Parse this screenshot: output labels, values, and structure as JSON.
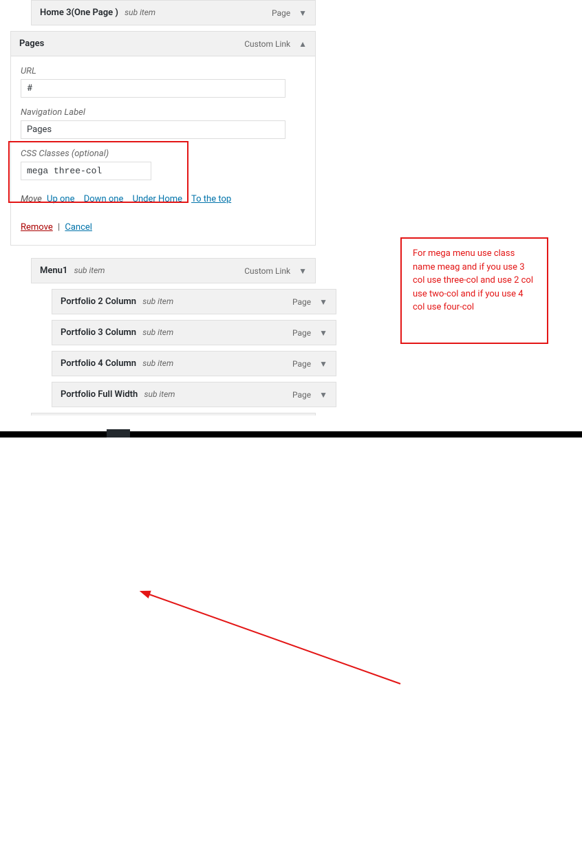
{
  "items": {
    "home3": {
      "title": "Home 3(One Page )",
      "sub": "sub item",
      "type": "Page"
    },
    "pages": {
      "title": "Pages",
      "type": "Custom Link"
    },
    "menu1": {
      "title": "Menu1",
      "sub": "sub item",
      "type": "Custom Link"
    },
    "pf2": {
      "title": "Portfolio 2 Column",
      "sub": "sub item",
      "type": "Page"
    },
    "pf3": {
      "title": "Portfolio 3 Column",
      "sub": "sub item",
      "type": "Page"
    },
    "pf4": {
      "title": "Portfolio 4 Column",
      "sub": "sub item",
      "type": "Page"
    },
    "pffw": {
      "title": "Portfolio Full Width",
      "sub": "sub item",
      "type": "Page"
    }
  },
  "fields": {
    "url_label": "URL",
    "url_value": "#",
    "nav_label": "Navigation Label",
    "nav_value": "Pages",
    "css_label": "CSS Classes (optional)",
    "css_value": "mega three-col"
  },
  "move": {
    "label": "Move",
    "up": "Up one",
    "down": "Down one",
    "under": "Under Home",
    "top": "To the top"
  },
  "actions": {
    "remove": "Remove",
    "cancel": "Cancel"
  },
  "annotation": "For mega menu use class name meag and if you use 3 col use three-col and use 2 col use two-col and if you use 4 col use four-col"
}
